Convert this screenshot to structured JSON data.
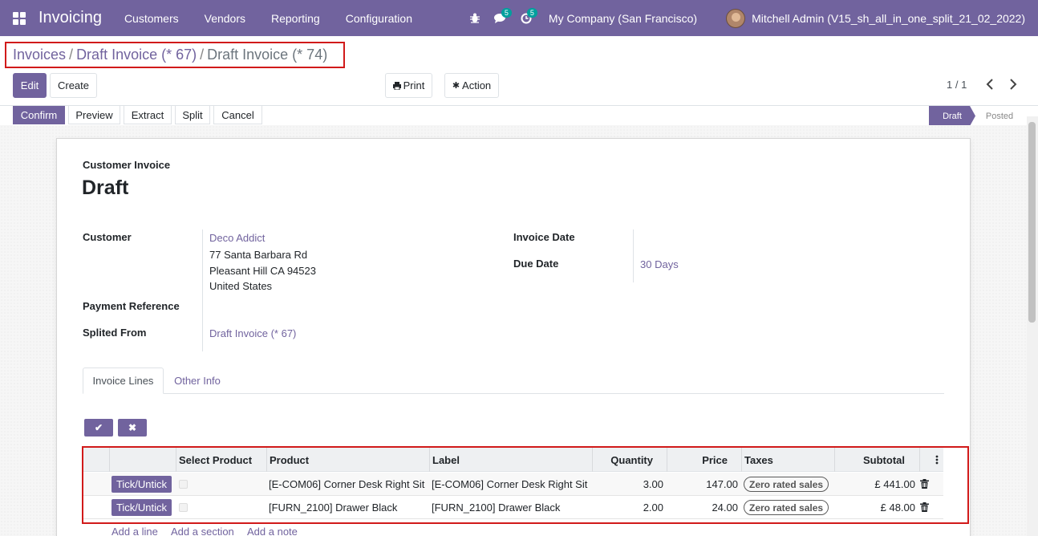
{
  "navbar": {
    "app_name": "Invoicing",
    "menu": [
      "Customers",
      "Vendors",
      "Reporting",
      "Configuration"
    ],
    "messages_badge": "5",
    "activities_badge": "5",
    "company": "My Company (San Francisco)",
    "user": "Mitchell Admin (V15_sh_all_in_one_split_21_02_2022)",
    "icons": [
      "apps-icon",
      "bug-icon",
      "comments-icon",
      "clock-icon"
    ]
  },
  "breadcrumb": {
    "items": [
      "Invoices",
      "Draft Invoice (* 67)",
      "Draft Invoice (* 74)"
    ],
    "separator": "/"
  },
  "control": {
    "edit": "Edit",
    "create": "Create",
    "print": "Print",
    "action": "Action",
    "pager": "1 / 1"
  },
  "statusbar": {
    "buttons": [
      "Confirm",
      "Preview",
      "Extract",
      "Split",
      "Cancel"
    ],
    "stages": [
      "Draft",
      "Posted"
    ],
    "active_stage": "Draft"
  },
  "form": {
    "type_label": "Customer Invoice",
    "title": "Draft",
    "customer_label": "Customer",
    "customer_name": "Deco Addict",
    "customer_address": [
      "77 Santa Barbara Rd",
      "Pleasant Hill CA 94523",
      "United States"
    ],
    "payment_ref_label": "Payment Reference",
    "splited_from_label": "Splited From",
    "splited_from_value": "Draft Invoice (* 67)",
    "invoice_date_label": "Invoice Date",
    "due_date_label": "Due Date",
    "due_date_value": "30 Days"
  },
  "tabs": [
    "Invoice Lines",
    "Other Info"
  ],
  "lines": {
    "save_icon": "✔",
    "discard_icon": "✖",
    "headers": [
      "Select Product",
      "Product",
      "Label",
      "Quantity",
      "Price",
      "Taxes",
      "Subtotal"
    ],
    "rows": [
      {
        "button": "Tick/Untick",
        "product": "[E-COM06] Corner Desk Right Sit",
        "label": "[E-COM06] Corner Desk Right Sit",
        "quantity": "3.00",
        "price": "147.00",
        "tax": "Zero rated sales",
        "subtotal": "£ 441.00"
      },
      {
        "button": "Tick/Untick",
        "product": "[FURN_2100] Drawer Black",
        "label": "[FURN_2100] Drawer Black",
        "quantity": "2.00",
        "price": "24.00",
        "tax": "Zero rated sales",
        "subtotal": "£ 48.00"
      }
    ],
    "add_links": [
      "Add a line",
      "Add a section",
      "Add a note"
    ]
  },
  "colors": {
    "brand": "#71639e",
    "highlight_border": "#d11a1a"
  }
}
